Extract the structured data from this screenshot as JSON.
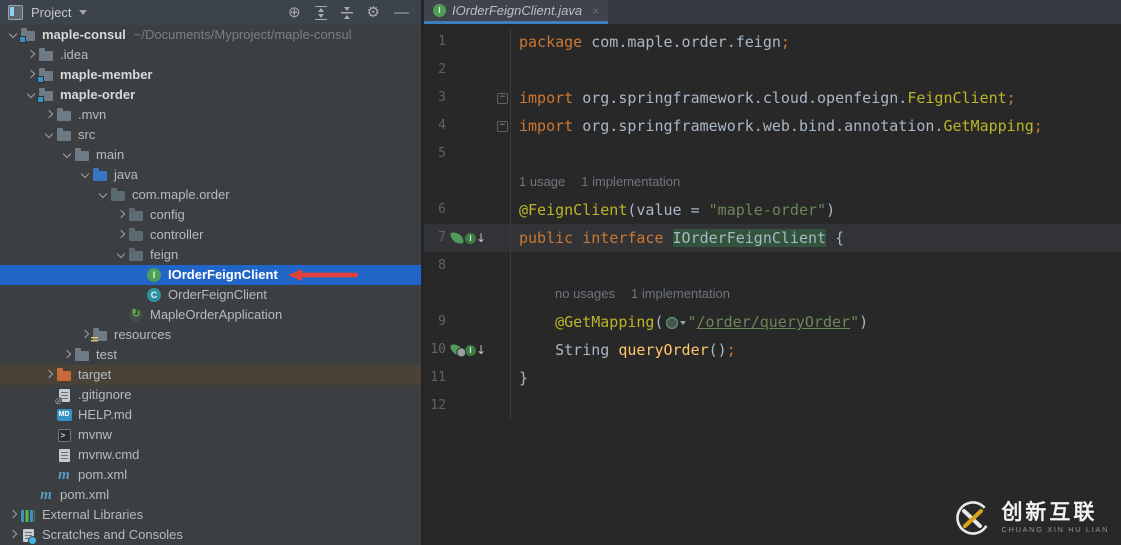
{
  "project_panel": {
    "title": "Project",
    "toolbar_icons": [
      "locate",
      "expand-all",
      "collapse-all",
      "settings",
      "hide-panel"
    ],
    "tree": [
      {
        "label": "maple-consul",
        "suffix": "~/Documents/Myproject/maple-consul",
        "level": 0,
        "icon": "folder-module",
        "chevron": "open",
        "bold": true
      },
      {
        "label": ".idea",
        "level": 1,
        "icon": "folder",
        "chevron": "closed"
      },
      {
        "label": "maple-member",
        "level": 1,
        "icon": "folder-module",
        "chevron": "closed",
        "bold": true
      },
      {
        "label": "maple-order",
        "level": 1,
        "icon": "folder-module",
        "chevron": "open",
        "bold": true
      },
      {
        "label": ".mvn",
        "level": 2,
        "icon": "folder",
        "chevron": "closed"
      },
      {
        "label": "src",
        "level": 2,
        "icon": "folder",
        "chevron": "open"
      },
      {
        "label": "main",
        "level": 3,
        "icon": "folder",
        "chevron": "open"
      },
      {
        "label": "java",
        "level": 4,
        "icon": "folder-source",
        "chevron": "open"
      },
      {
        "label": "com.maple.order",
        "level": 5,
        "icon": "package",
        "chevron": "open"
      },
      {
        "label": "config",
        "level": 6,
        "icon": "package-folder",
        "chevron": "closed"
      },
      {
        "label": "controller",
        "level": 6,
        "icon": "package-folder",
        "chevron": "closed"
      },
      {
        "label": "feign",
        "level": 6,
        "icon": "package-folder",
        "chevron": "open"
      },
      {
        "label": "IOrderFeignClient",
        "level": 7,
        "icon": "interface",
        "selected": true,
        "arrow": true
      },
      {
        "label": "OrderFeignClient",
        "level": 7,
        "icon": "class"
      },
      {
        "label": "MapleOrderApplication",
        "level": 6,
        "icon": "spring-boot"
      },
      {
        "label": "resources",
        "level": 4,
        "icon": "folder-resources",
        "chevron": "closed"
      },
      {
        "label": "test",
        "level": 3,
        "icon": "folder",
        "chevron": "closed"
      },
      {
        "label": "target",
        "level": 2,
        "icon": "folder-excluded",
        "chevron": "closed",
        "excluded": true
      },
      {
        "label": ".gitignore",
        "level": 2,
        "icon": "file-ignored"
      },
      {
        "label": "HELP.md",
        "level": 2,
        "icon": "file-markdown"
      },
      {
        "label": "mvnw",
        "level": 2,
        "icon": "file-console"
      },
      {
        "label": "mvnw.cmd",
        "level": 2,
        "icon": "file-text"
      },
      {
        "label": "pom.xml",
        "level": 2,
        "icon": "maven"
      },
      {
        "label": "pom.xml",
        "level": 1,
        "icon": "maven"
      },
      {
        "label": "External Libraries",
        "level": 0,
        "icon": "libraries",
        "chevron": "closed"
      },
      {
        "label": "Scratches and Consoles",
        "level": 0,
        "icon": "scratches",
        "chevron": "closed"
      }
    ]
  },
  "editor": {
    "tab": {
      "label": "IOrderFeignClient.java",
      "icon": "interface",
      "close_label": "×"
    },
    "lines": [
      {
        "type": "code",
        "num": "1",
        "segs": [
          {
            "t": "package ",
            "c": "kw"
          },
          {
            "t": "com.maple.order.feign",
            "c": "pl"
          },
          {
            "t": ";",
            "c": "semi"
          }
        ]
      },
      {
        "type": "code",
        "num": "2",
        "segs": []
      },
      {
        "type": "code",
        "num": "3",
        "fold": "minus",
        "segs": [
          {
            "t": "import ",
            "c": "kw"
          },
          {
            "t": "org.springframework.cloud.openfeign.",
            "c": "pl"
          },
          {
            "t": "FeignClient",
            "c": "ann"
          },
          {
            "t": ";",
            "c": "semi"
          }
        ]
      },
      {
        "type": "code",
        "num": "4",
        "fold": "minus",
        "segs": [
          {
            "t": "import ",
            "c": "kw"
          },
          {
            "t": "org.springframework.web.bind.annotation.",
            "c": "pl"
          },
          {
            "t": "GetMapping",
            "c": "ann"
          },
          {
            "t": ";",
            "c": "semi"
          }
        ]
      },
      {
        "type": "code",
        "num": "5",
        "segs": []
      },
      {
        "type": "hint",
        "indent": 0,
        "hints": [
          "1 usage",
          "1 implementation"
        ]
      },
      {
        "type": "code",
        "num": "6",
        "segs": [
          {
            "t": "@FeignClient",
            "c": "ann"
          },
          {
            "t": "(value ",
            "c": "pl"
          },
          {
            "t": "= ",
            "c": "pl"
          },
          {
            "t": "\"maple-order\"",
            "c": "str"
          },
          {
            "t": ")",
            "c": "pl"
          }
        ]
      },
      {
        "type": "code",
        "num": "7",
        "current": true,
        "gicons": [
          "spring-bean",
          "implemented"
        ],
        "segs": [
          {
            "t": "public interface ",
            "c": "kw"
          },
          {
            "t": "IOrderFeignClient",
            "c": "pl",
            "hl": true
          },
          {
            "t": " {",
            "c": "pl"
          }
        ]
      },
      {
        "type": "code",
        "num": "8",
        "segs": []
      },
      {
        "type": "hint",
        "indent": 1,
        "hints": [
          "no usages",
          "1 implementation"
        ]
      },
      {
        "type": "code",
        "num": "9",
        "segs": [
          {
            "t": "    ",
            "c": "pl"
          },
          {
            "t": "@GetMapping",
            "c": "ann"
          },
          {
            "t": "(",
            "c": "pl"
          },
          {
            "icon": "url-inlay"
          },
          {
            "t": "\"",
            "c": "str"
          },
          {
            "t": "/order/queryOrder",
            "c": "str-link"
          },
          {
            "t": "\"",
            "c": "str"
          },
          {
            "t": ")",
            "c": "pl"
          }
        ]
      },
      {
        "type": "code",
        "num": "10",
        "gicons": [
          "spring-mapping",
          "implemented"
        ],
        "segs": [
          {
            "t": "    ",
            "c": "pl"
          },
          {
            "t": "String ",
            "c": "pl"
          },
          {
            "t": "queryOrder",
            "c": "mth"
          },
          {
            "t": "()",
            "c": "pl"
          },
          {
            "t": ";",
            "c": "semi"
          }
        ]
      },
      {
        "type": "code",
        "num": "11",
        "segs": [
          {
            "t": "}",
            "c": "pl"
          }
        ]
      },
      {
        "type": "code",
        "num": "12",
        "segs": []
      }
    ]
  },
  "watermark": {
    "name_cn": "创新互联",
    "name_en": "CHUANG XIN HU LIAN"
  },
  "colors": {
    "selection_blue": "#2065c7",
    "excluded_row": "#4b4237",
    "tab_underline": "#3d7ebe",
    "keyword": "#cc7832",
    "annotation": "#bbb529",
    "string": "#6a8759",
    "method": "#ffc66d",
    "arrow_red": "#e0403c"
  }
}
